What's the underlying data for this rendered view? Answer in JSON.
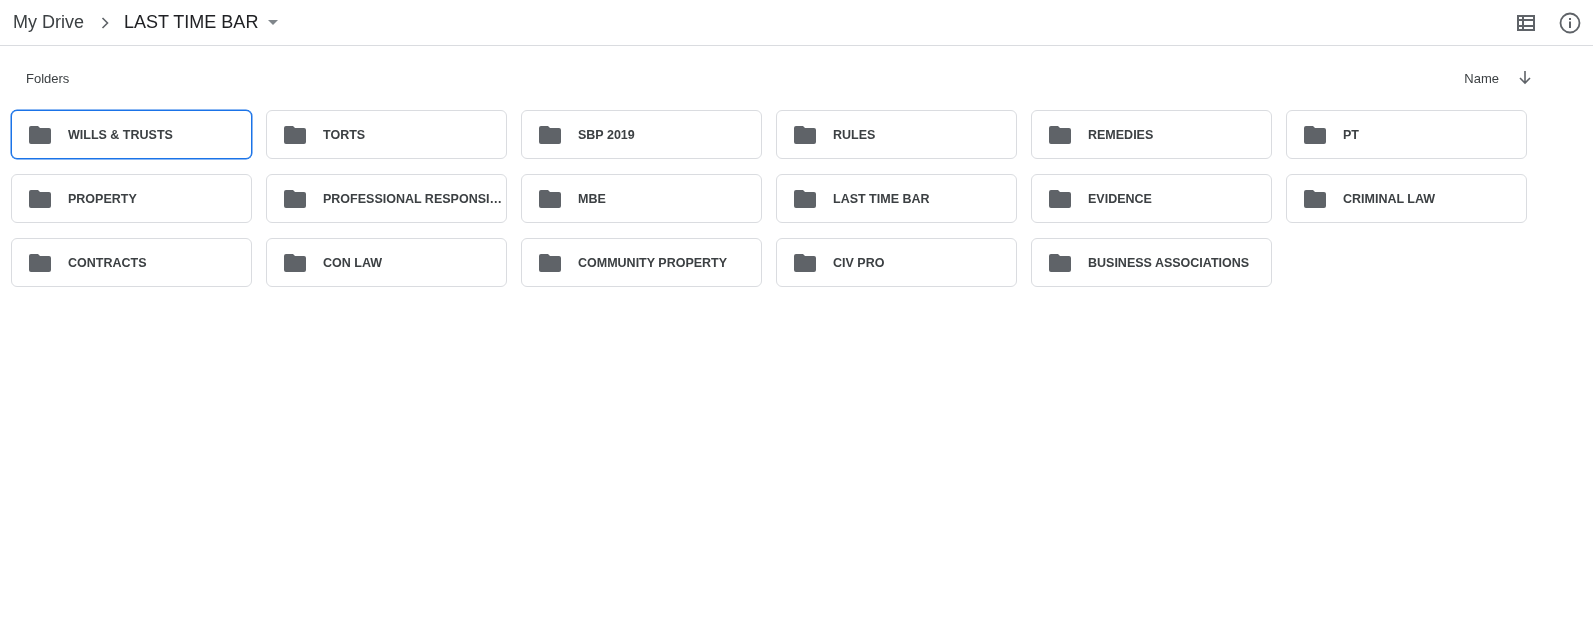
{
  "breadcrumb": {
    "root": "My Drive",
    "current": "LAST TIME BAR"
  },
  "section_label": "Folders",
  "sort": {
    "label": "Name"
  },
  "folders": [
    {
      "name": "WILLS & TRUSTS",
      "selected": true
    },
    {
      "name": "TORTS",
      "selected": false
    },
    {
      "name": "SBP 2019",
      "selected": false
    },
    {
      "name": "RULES",
      "selected": false
    },
    {
      "name": "REMEDIES",
      "selected": false
    },
    {
      "name": "PT",
      "selected": false
    },
    {
      "name": "PROPERTY",
      "selected": false
    },
    {
      "name": "PROFESSIONAL RESPONSI…",
      "selected": false
    },
    {
      "name": "MBE",
      "selected": false
    },
    {
      "name": "LAST TIME BAR",
      "selected": false
    },
    {
      "name": "EVIDENCE",
      "selected": false
    },
    {
      "name": "CRIMINAL LAW",
      "selected": false
    },
    {
      "name": "CONTRACTS",
      "selected": false
    },
    {
      "name": "CON LAW",
      "selected": false
    },
    {
      "name": "COMMUNITY PROPERTY",
      "selected": false
    },
    {
      "name": "CIV PRO",
      "selected": false
    },
    {
      "name": "BUSINESS ASSOCIATIONS",
      "selected": false
    }
  ]
}
